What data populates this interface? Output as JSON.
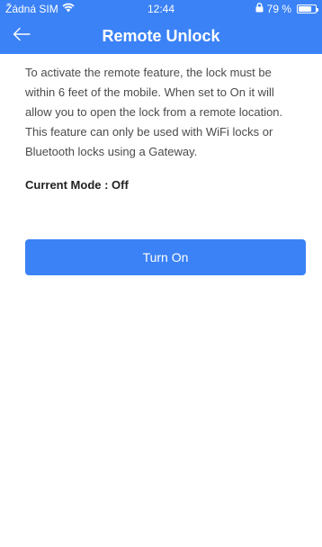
{
  "status_bar": {
    "carrier": "Žádná SIM",
    "time": "12:44",
    "battery_percent": "79 %",
    "battery_level": 0.79
  },
  "header": {
    "title": "Remote Unlock"
  },
  "main": {
    "description": "To activate the remote feature, the lock must be within 6 feet of the mobile. When set to On it will allow you to open the lock from a remote location. This feature can only be used with WiFi locks or Bluetooth locks using a Gateway.",
    "current_mode": "Current Mode : Off",
    "turn_on_label": "Turn On"
  },
  "colors": {
    "primary": "#3b82f6",
    "text": "#4b4b4b",
    "background": "#ffffff"
  },
  "icons": {
    "back": "arrow-left-icon",
    "wifi": "wifi-icon",
    "battery": "battery-icon",
    "orientation_lock": "orientation-lock-icon"
  }
}
